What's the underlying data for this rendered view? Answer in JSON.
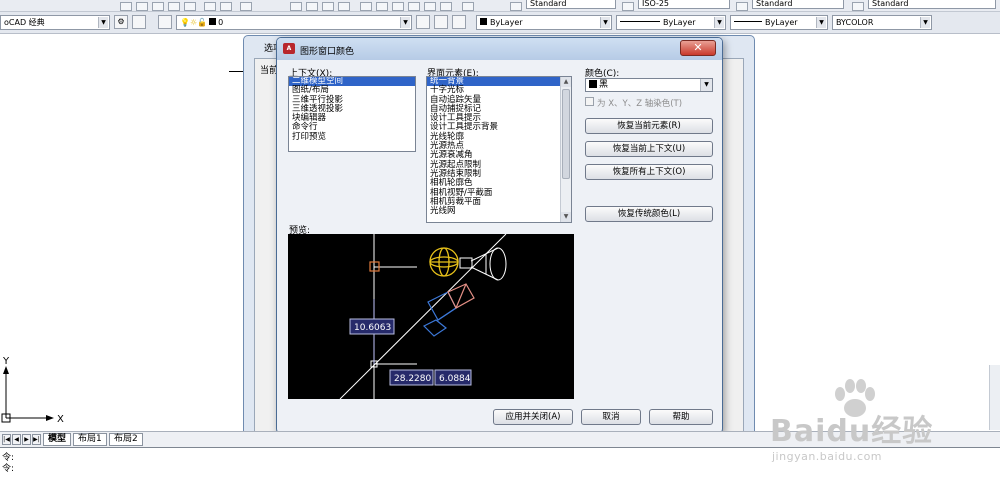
{
  "toolbar": {
    "workspace": "oCAD 经典",
    "layer_value": "0",
    "text_style": "Standard",
    "dim_style": "ISO-25",
    "table_style": "Standard",
    "multileader_style": "Standard",
    "color": "ByLayer",
    "linetype": "ByLayer",
    "lineweight": "ByLayer",
    "plotstyle": "BYCOLOR"
  },
  "back_dialog": {
    "title": "选项",
    "current_label": "当前"
  },
  "dialog": {
    "title": "图形窗口颜色",
    "context_label": "上下文(X):",
    "context_items": [
      "二维模型空间",
      "图纸/布局",
      "三维平行投影",
      "三维透视投影",
      "块编辑器",
      "命令行",
      "打印预览"
    ],
    "context_selected": 0,
    "element_label": "界面元素(E):",
    "element_items": [
      "统一背景",
      "十字光标",
      "自动追踪矢量",
      "自动捕捉标记",
      "设计工具提示",
      "设计工具提示背景",
      "光线轮廓",
      "光源热点",
      "光源衰减角",
      "光源起点限制",
      "光源结束限制",
      "相机轮廓色",
      "相机视野/平截面",
      "相机剪裁平面",
      "光线网"
    ],
    "element_selected": 0,
    "color_label": "颜色(C):",
    "color_value": "黑",
    "tint_label": "为 X、Y、Z 轴染色(T)",
    "buttons": {
      "restore_element": "恢复当前元素(R)",
      "restore_context": "恢复当前上下文(U)",
      "restore_all": "恢复所有上下文(O)",
      "restore_classic": "恢复传统颜色(L)",
      "apply_close": "应用并关闭(A)",
      "cancel": "取消",
      "help": "帮助"
    },
    "preview_label": "预览:",
    "preview_values": [
      "10.6063",
      "28.2280",
      "6.0884"
    ]
  },
  "tabs": [
    "模型",
    "布局1",
    "布局2"
  ],
  "command_prompts": [
    "令:",
    "令:"
  ],
  "ucs": {
    "y": "Y",
    "x": "X"
  },
  "watermark": {
    "brand": "Baidu经验",
    "sub": "jingyan.baidu.com"
  },
  "colors": {
    "selection": "#2f64c8",
    "preview_bg": "#000000",
    "crosshair": "#ffffff",
    "light": "#e8c21a"
  }
}
